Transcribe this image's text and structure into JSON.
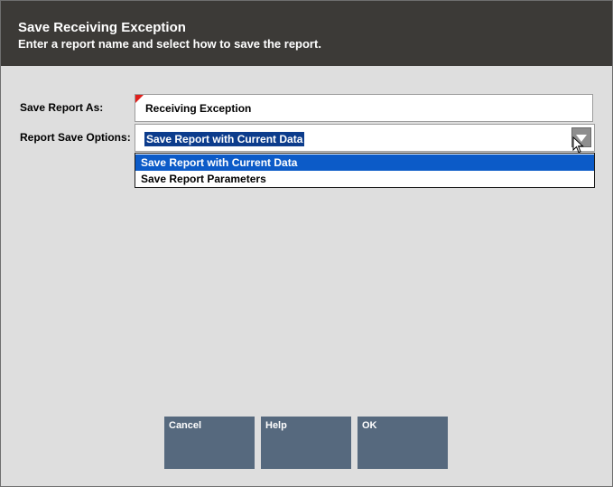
{
  "dialog": {
    "title": "Save Receiving Exception",
    "subtitle": "Enter a report name and select how to save the report."
  },
  "form": {
    "name_label": "Save Report As:",
    "name_value": "Receiving Exception",
    "options_label": "Report Save Options:",
    "options_selected": "Save Report with Current Data",
    "options": [
      "Save Report with Current Data",
      "Save Report Parameters"
    ]
  },
  "buttons": {
    "cancel": "Cancel",
    "help": "Help",
    "ok": "OK"
  },
  "colors": {
    "header_bg": "#3c3a37",
    "button_bg": "#56697e",
    "highlight": "#0c5bc8",
    "required_marker": "#e0201c"
  },
  "icons": {
    "dropdown": "triangle-down",
    "cursor": "mouse-pointer"
  }
}
